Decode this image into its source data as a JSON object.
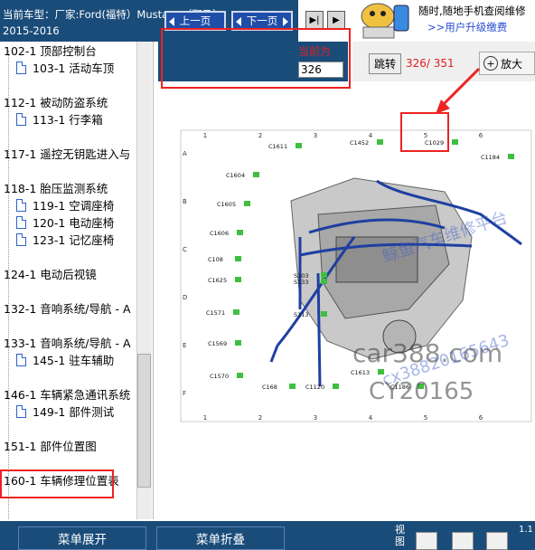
{
  "header": {
    "car_line": "当前车型：厂家:Ford(福特）Mustang（野马）",
    "years": "2015-2016"
  },
  "ad": {
    "line1": "随时,随地手机查阅维修",
    "line2": ">>用户升级缴费"
  },
  "nav": {
    "prev_label": "上一页",
    "next_label": "下一页",
    "current_label": "当前为",
    "current_value": "326"
  },
  "toolbar": {
    "jump_label": "跳转",
    "pages": "326/ 351",
    "zoom_label": "放大"
  },
  "sidebar": {
    "items": [
      {
        "label": "102-1 顶部控制台",
        "level": "top"
      },
      {
        "label": "103-1 活动车顶",
        "level": "sub"
      },
      {
        "label": "112-1 被动防盗系统",
        "level": "top"
      },
      {
        "label": "113-1 行李箱",
        "level": "sub"
      },
      {
        "label": "117-1 遥控无钥匙进入与",
        "level": "top"
      },
      {
        "label": "118-1 胎压监测系统",
        "level": "top"
      },
      {
        "label": "119-1 空调座椅",
        "level": "sub"
      },
      {
        "label": "120-1 电动座椅",
        "level": "sub"
      },
      {
        "label": "123-1 记忆座椅",
        "level": "sub"
      },
      {
        "label": "124-1 电动后视镜",
        "level": "top"
      },
      {
        "label": "132-1 音响系统/导航 - A",
        "level": "top"
      },
      {
        "label": "133-1 音响系统/导航 - A",
        "level": "top"
      },
      {
        "label": "145-1 驻车辅助",
        "level": "sub"
      },
      {
        "label": "146-1 车辆紧急通讯系统",
        "level": "top"
      },
      {
        "label": "149-1 部件测试",
        "level": "sub"
      },
      {
        "label": "151-1 部件位置图",
        "level": "top"
      },
      {
        "label": "160-1 车辆修理位置表",
        "level": "top"
      }
    ]
  },
  "bottom": {
    "expand_label": "菜单展开",
    "collapse_label": "菜单折叠",
    "view_label": "视图",
    "version": "1.1"
  },
  "diagram": {
    "col_labels": [
      "1",
      "2",
      "3",
      "4",
      "5",
      "6"
    ],
    "row_labels": [
      "A",
      "B",
      "C",
      "D",
      "E",
      "F"
    ],
    "connectors": [
      "C1611",
      "C1452",
      "C1029",
      "C1184",
      "C1604",
      "C1605",
      "C1606",
      "C108",
      "C1625",
      "C1571",
      "C1569",
      "C1570",
      "C168",
      "C1120",
      "C1613",
      "C1186",
      "S103",
      "S133",
      "S113"
    ]
  },
  "watermarks": {
    "w1": "car388.com",
    "w2": "CY20165",
    "w3": "鲸鱼汽车维修平台",
    "w4": "cx38820165643"
  },
  "colors": {
    "header_bg": "#1a4c7a",
    "accent_red": "#e22222",
    "harness_blue": "#1f3fa0",
    "connector_green": "#3fbf3f"
  }
}
